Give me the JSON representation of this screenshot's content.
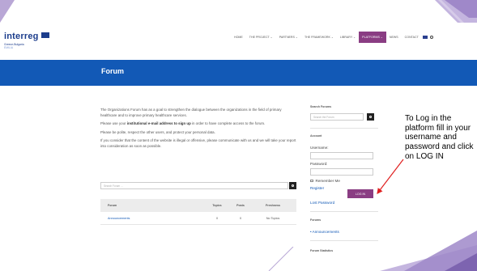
{
  "header": {
    "logo": {
      "name": "interreg",
      "subtitle": "Greece-Bulgaria",
      "region": "EMILIA"
    },
    "nav": [
      {
        "label": "HOME"
      },
      {
        "label": "THE PROJECT ⌄"
      },
      {
        "label": "PARTNERS ⌄"
      },
      {
        "label": "THE FRAMEWORK ⌄"
      },
      {
        "label": "LIBRARY ⌄"
      },
      {
        "label": "PLATFORMS ⌄",
        "active": true
      },
      {
        "label": "NEWS"
      },
      {
        "label": "CONTACT"
      }
    ]
  },
  "banner": {
    "title": "Forum"
  },
  "main": {
    "intro": "The Organizations Forum has as a goal to strengthen the dialogue between the organizations in the field of primary healthcare and to improve primary healthcare services.",
    "signup_prefix": "Please use your ",
    "signup_bold": "institutional e-mail address to sign up",
    "signup_suffix": " in order to have complete access to the forum.",
    "polite": "Please be polite, respect the other users, and protect your personal data.",
    "offensive": "If you consider that the content of the website is illegal or offensive, please communicate with us and we will take your report into consideration as soon as possible.",
    "search_placeholder": "Search Forum ...",
    "table": {
      "headers": [
        "Forum",
        "Topics",
        "Posts",
        "Freshness"
      ],
      "rows": [
        {
          "forum": "Announcements",
          "topics": "0",
          "posts": "0",
          "freshness": "No Topics"
        }
      ]
    }
  },
  "sidebar": {
    "search_heading": "Search Forums",
    "search_placeholder": "Search the Forum",
    "account_heading": "Account",
    "username_label": "Username:",
    "password_label": "Password:",
    "remember_label": "Remember Me",
    "register_link": "Register",
    "login_button": "LOG IN",
    "lost_password_link": "Lost Password",
    "forums_heading": "Forums",
    "forums_link": "Announcements",
    "stats_heading": "Forum Statistics"
  },
  "callout": {
    "text": "To Log in the platform fill in your username and password and click on LOG IN"
  },
  "colors": {
    "accent": "#8a3d83",
    "banner": "#1259b6",
    "arrow": "#e02020"
  }
}
